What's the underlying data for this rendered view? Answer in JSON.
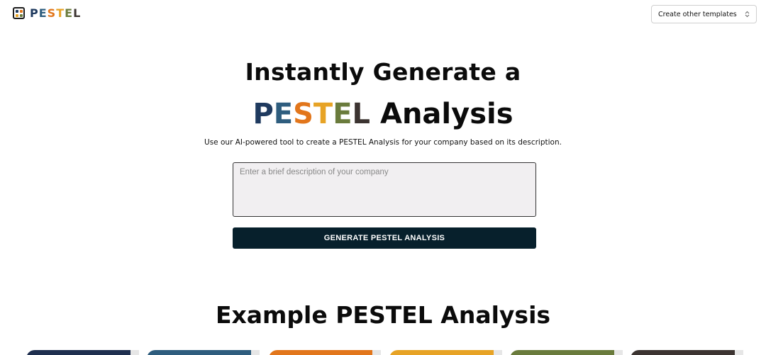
{
  "header": {
    "logo_letters": [
      {
        "char": "P",
        "color": "#1f3a5f"
      },
      {
        "char": "E",
        "color": "#2e5d7e"
      },
      {
        "char": "S",
        "color": "#e2761b"
      },
      {
        "char": "T",
        "color": "#e7a325"
      },
      {
        "char": "E",
        "color": "#6a7b3c"
      },
      {
        "char": "L",
        "color": "#3c3431"
      }
    ],
    "logo_icon_colors": [
      "#1f3a5f",
      "#e2761b",
      "#e7a325",
      "#6a7b3c"
    ],
    "template_select": {
      "selected": "Create other templates",
      "icon": "chevron-updown-icon"
    }
  },
  "hero": {
    "line1": "Instantly Generate a",
    "pestel_letters": [
      {
        "char": "P",
        "color": "#1f3a5f"
      },
      {
        "char": "E",
        "color": "#2e5d7e"
      },
      {
        "char": "S",
        "color": "#e2761b"
      },
      {
        "char": "T",
        "color": "#e7a325"
      },
      {
        "char": "E",
        "color": "#6a7b3c"
      },
      {
        "char": "L",
        "color": "#3c3431"
      }
    ],
    "line2_suffix": "Analysis",
    "subtitle": "Use our AI-powered tool to create a PESTEL Analysis for your company based on its description."
  },
  "form": {
    "description_value": "",
    "description_placeholder": "Enter a brief description of your company",
    "generate_label": "GENERATE PESTEL ANALYSIS",
    "button_color": "#07202c"
  },
  "examples": {
    "title": "Example PESTEL Analysis",
    "card_colors": [
      "#1f2f4f",
      "#2e5d7e",
      "#e2761b",
      "#e7a325",
      "#6a7b3c",
      "#3c3431"
    ]
  }
}
